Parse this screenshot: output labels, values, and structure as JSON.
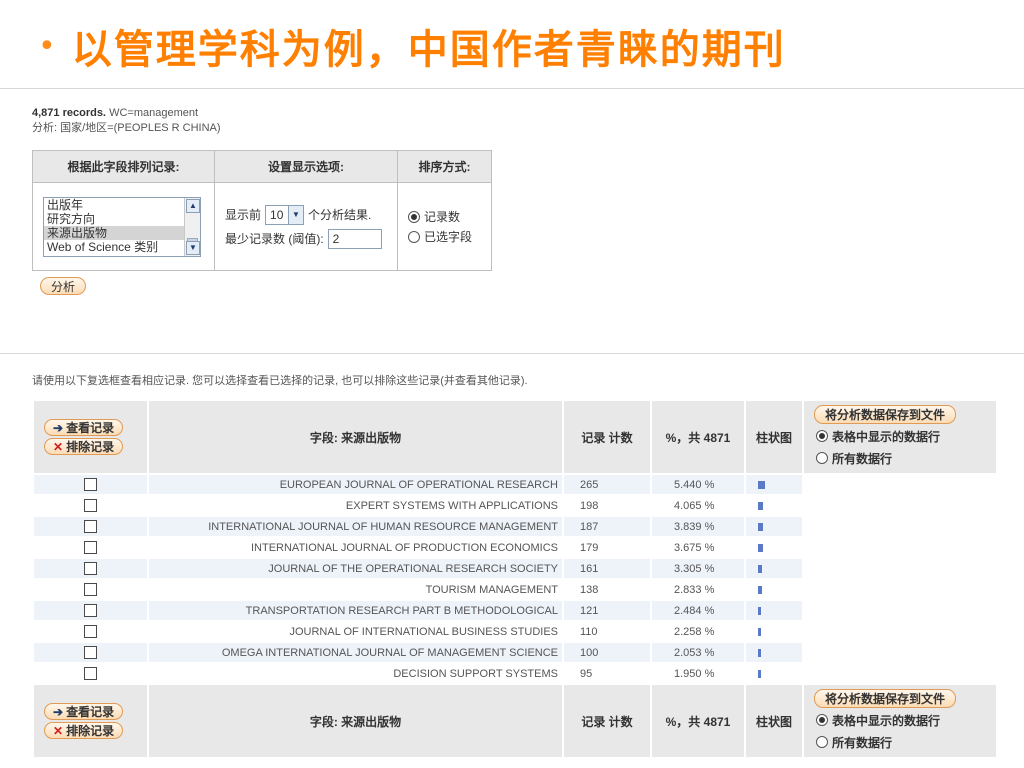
{
  "slide": {
    "bullet": "•",
    "title": "以管理学科为例，中国作者青睐的期刊"
  },
  "summary": {
    "records": "4,871 records.",
    "query": "WC=management",
    "filter": "分析: 国家/地区=(PEOPLES R CHINA)"
  },
  "options": {
    "headers": [
      "根据此字段排列记录:",
      "设置显示选项:",
      "排序方式:"
    ],
    "field_list": [
      {
        "label": "出版年",
        "selected": false
      },
      {
        "label": "研究方向",
        "selected": false
      },
      {
        "label": "来源出版物",
        "selected": true
      },
      {
        "label": "Web of Science 类别",
        "selected": false
      }
    ],
    "show_prefix": "显示前",
    "show_value": "10",
    "show_suffix": "个分析结果.",
    "min_label": "最少记录数 (阈值):",
    "min_value": "2",
    "sort_options": [
      {
        "label": "记录数",
        "checked": true
      },
      {
        "label": "已选字段",
        "checked": false
      }
    ],
    "analyze_label": "分析"
  },
  "instruction": "请使用以下复选框查看相应记录. 您可以选择查看已选择的记录, 也可以排除这些记录(并查看其他记录).",
  "results": {
    "view_label": "查看记录",
    "exclude_label": "排除记录",
    "field_header": "字段: 来源出版物",
    "count_header": "记录 计数",
    "pct_header": "%，共 4871",
    "bar_header": "柱状图",
    "save_label": "将分析数据保存到文件",
    "save_options": [
      {
        "label": "表格中显示的数据行",
        "checked": true
      },
      {
        "label": "所有数据行",
        "checked": false
      }
    ],
    "rows": [
      {
        "name": "EUROPEAN JOURNAL OF OPERATIONAL RESEARCH",
        "count": "265",
        "pct": "5.440 %",
        "share": 5.44
      },
      {
        "name": "EXPERT SYSTEMS WITH APPLICATIONS",
        "count": "198",
        "pct": "4.065 %",
        "share": 4.065
      },
      {
        "name": "INTERNATIONAL JOURNAL OF HUMAN RESOURCE MANAGEMENT",
        "count": "187",
        "pct": "3.839 %",
        "share": 3.839
      },
      {
        "name": "INTERNATIONAL JOURNAL OF PRODUCTION ECONOMICS",
        "count": "179",
        "pct": "3.675 %",
        "share": 3.675
      },
      {
        "name": "JOURNAL OF THE OPERATIONAL RESEARCH SOCIETY",
        "count": "161",
        "pct": "3.305 %",
        "share": 3.305
      },
      {
        "name": "TOURISM MANAGEMENT",
        "count": "138",
        "pct": "2.833 %",
        "share": 2.833
      },
      {
        "name": "TRANSPORTATION RESEARCH PART B METHODOLOGICAL",
        "count": "121",
        "pct": "2.484 %",
        "share": 2.484
      },
      {
        "name": "JOURNAL OF INTERNATIONAL BUSINESS STUDIES",
        "count": "110",
        "pct": "2.258 %",
        "share": 2.258
      },
      {
        "name": "OMEGA INTERNATIONAL JOURNAL OF MANAGEMENT SCIENCE",
        "count": "100",
        "pct": "2.053 %",
        "share": 2.053
      },
      {
        "name": "DECISION SUPPORT SYSTEMS",
        "count": "95",
        "pct": "1.950 %",
        "share": 1.95
      }
    ]
  },
  "colors": {
    "title": "#ff7f00",
    "bar": "#5a7ac7",
    "row_alt": "#eef3fa",
    "header_bg": "#e8e8e8"
  }
}
